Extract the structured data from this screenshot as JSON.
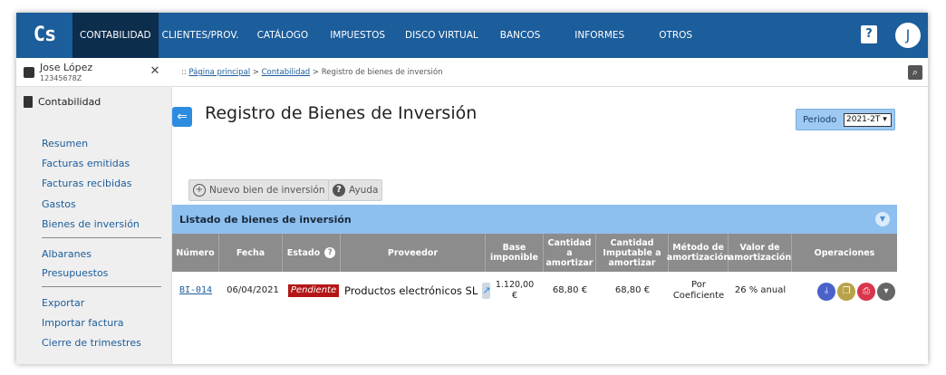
{
  "logo": "Cs",
  "nav": [
    "CONTABILIDAD",
    "CLIENTES/PROV.",
    "CATÁLOGO",
    "IMPUESTOS",
    "DISCO VIRTUAL",
    "BANCOS",
    "INFORMES",
    "OTROS"
  ],
  "user": {
    "name": "Jose López",
    "id": "12345678Z",
    "avatar_initial": "J"
  },
  "help_glyph": "?",
  "sidebar": {
    "section_title": "Contabilidad",
    "group1": [
      "Resumen",
      "Facturas emitidas",
      "Facturas recibidas",
      "Gastos",
      "Bienes de inversión"
    ],
    "group2": [
      "Albaranes",
      "Presupuestos"
    ],
    "group3": [
      "Exportar",
      "Importar factura",
      "Cierre de trimestres"
    ]
  },
  "breadcrumb": {
    "prefix": ":: ",
    "home": "Página principal",
    "sep1": " > ",
    "section": "Contabilidad",
    "sep2": " > ",
    "current": "Registro de bienes de inversión"
  },
  "page_title": "Registro de Bienes de Inversión",
  "period": {
    "label": "Periodo",
    "selected": "2021-2T"
  },
  "buttons": {
    "new": "Nuevo bien de inversión",
    "help": "Ayuda"
  },
  "list_title": "Listado de bienes de inversión",
  "columns": [
    "Número",
    "Fecha",
    "Estado",
    "Proveedor",
    "Base imponible",
    "Cantidad a amortizar",
    "Cantidad Imputable a amortizar",
    "Método de amortización",
    "Valor de amortización",
    "Operaciones"
  ],
  "rows": [
    {
      "numero": "BI-014",
      "fecha": "06/04/2021",
      "estado": "Pendiente",
      "proveedor": "Productos electrónicos SL",
      "base": "1.120,00 €",
      "cantidad": "68,80 €",
      "imputable": "68,80 €",
      "metodo": "Por Coeficiente",
      "valor": "26 % anual"
    }
  ],
  "colors": {
    "nav_bg": "#1c5d9b",
    "nav_active": "#0d2d4d",
    "list_header": "#8dbfef",
    "table_header": "#8c8c8c",
    "badge": "#b41616"
  }
}
